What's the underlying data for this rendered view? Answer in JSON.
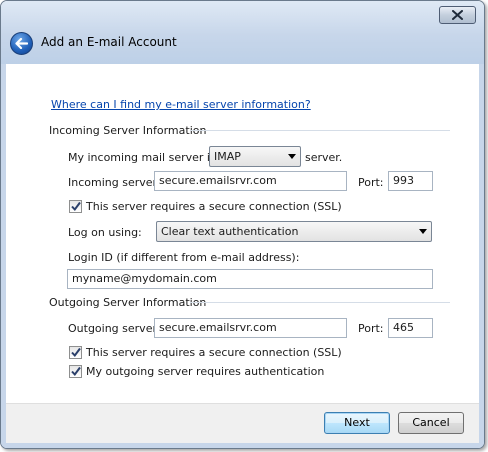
{
  "window": {
    "title": "Add an E-mail Account",
    "close_icon": "close-icon",
    "back_icon": "back-arrow-icon"
  },
  "help_link": "Where can I find my e-mail server information?",
  "incoming": {
    "group_label": "Incoming Server Information",
    "type_prefix": "My incoming mail server is a",
    "type_value": "IMAP",
    "type_suffix": "server.",
    "server_label": "Incoming server:",
    "server_value": "secure.emailsrvr.com",
    "port_label": "Port:",
    "port_value": "993",
    "ssl_label": "This server requires a secure connection (SSL)",
    "ssl_checked": true,
    "logon_label": "Log on using:",
    "logon_value": "Clear text authentication",
    "login_id_label": "Login ID (if different from e-mail address):",
    "login_id_value": "myname@mydomain.com"
  },
  "outgoing": {
    "group_label": "Outgoing Server Information",
    "server_label": "Outgoing server:",
    "server_value": "secure.emailsrvr.com",
    "port_label": "Port:",
    "port_value": "465",
    "ssl_label": "This server requires a secure connection (SSL)",
    "ssl_checked": true,
    "auth_label": "My outgoing server requires authentication",
    "auth_checked": true
  },
  "buttons": {
    "next": "Next",
    "cancel": "Cancel"
  },
  "colors": {
    "link": "#0645ad",
    "title_bar": "#c7d6ea",
    "default_button_border": "#3c7fb1"
  }
}
